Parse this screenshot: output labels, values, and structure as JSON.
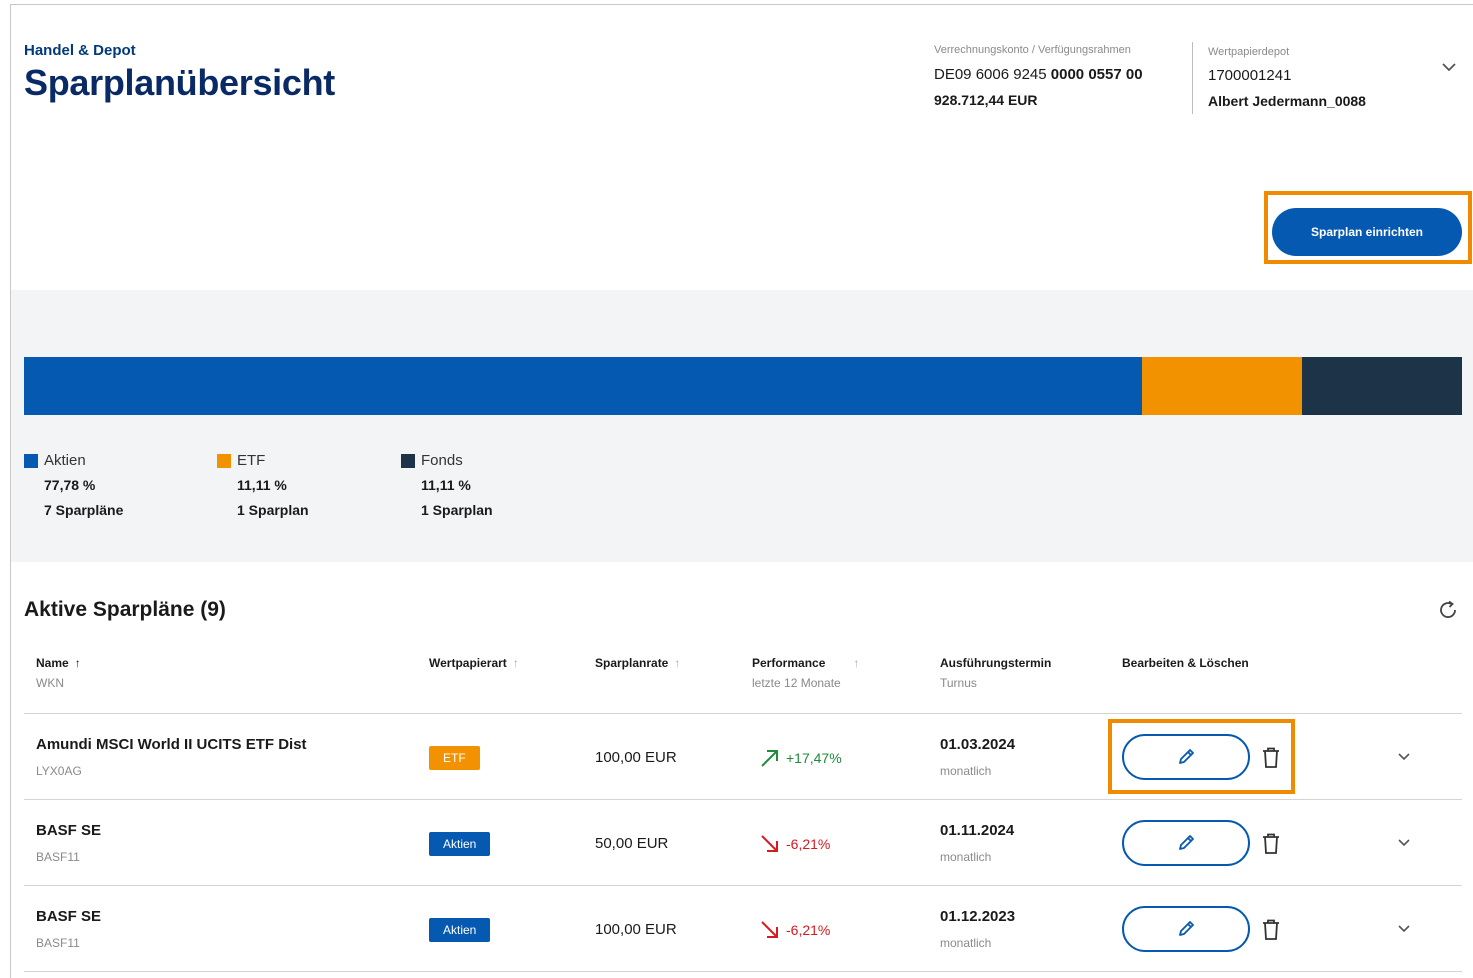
{
  "header": {
    "breadcrumb": "Handel & Depot",
    "title": "Sparplanübersicht",
    "account_label": "Verrechnungskonto / Verfügungsrahmen",
    "iban_prefix": "DE09 6006 9245",
    "iban_suffix": "0000 0557 00",
    "balance": "928.712,44 EUR",
    "depot_label": "Wertpapierdepot",
    "depot_number": "1700001241",
    "depot_owner": "Albert Jedermann_0088",
    "cta_label": "Sparplan einrichten"
  },
  "allocation": {
    "segments": [
      {
        "label": "Aktien",
        "share": 0.7778,
        "color": "#0659b0"
      },
      {
        "label": "ETF",
        "share": 0.1111,
        "color": "#f39200"
      },
      {
        "label": "Fonds",
        "share": 0.1111,
        "color": "#1d3448"
      }
    ],
    "legend": [
      {
        "label": "Aktien",
        "pct": "77,78 %",
        "count": "7 Sparpläne"
      },
      {
        "label": "ETF",
        "pct": "11,11 %",
        "count": "1 Sparplan"
      },
      {
        "label": "Fonds",
        "pct": "11,11 %",
        "count": "1 Sparplan"
      }
    ]
  },
  "table": {
    "title": "Aktive Sparpläne (9)",
    "columns": [
      {
        "label": "Name",
        "sub": "WKN"
      },
      {
        "label": "Wertpapierart",
        "sub": ""
      },
      {
        "label": "Sparplanrate",
        "sub": ""
      },
      {
        "label": "Performance",
        "sub": "letzte 12 Monate"
      },
      {
        "label": "Ausführungstermin",
        "sub": "Turnus"
      },
      {
        "label": "Bearbeiten & Löschen",
        "sub": ""
      }
    ],
    "rows": [
      {
        "name": "Amundi MSCI World II UCITS ETF Dist",
        "wkn": "LYX0AG",
        "type": "ETF",
        "type_color": "#f39200",
        "rate": "100,00 EUR",
        "perf": "+17,47%",
        "perf_dir": "up",
        "date": "01.03.2024",
        "turnus": "monatlich"
      },
      {
        "name": "BASF SE",
        "wkn": "BASF11",
        "type": "Aktien",
        "type_color": "#0659b0",
        "rate": "50,00 EUR",
        "perf": "-6,21%",
        "perf_dir": "down",
        "date": "01.11.2024",
        "turnus": "monatlich"
      },
      {
        "name": "BASF SE",
        "wkn": "BASF11",
        "type": "Aktien",
        "type_color": "#0659b0",
        "rate": "100,00 EUR",
        "perf": "-6,21%",
        "perf_dir": "down",
        "date": "01.12.2023",
        "turnus": "monatlich"
      }
    ]
  },
  "colors": {
    "primary": "#0659b0",
    "highlight": "#f08a00",
    "positive": "#1e8c3a",
    "negative": "#d71920"
  },
  "icons": {
    "header_expand": "chevron-down-icon",
    "refresh": "refresh-icon",
    "edit": "pencil-icon",
    "delete": "trash-icon",
    "row_expand": "chevron-down-icon"
  }
}
